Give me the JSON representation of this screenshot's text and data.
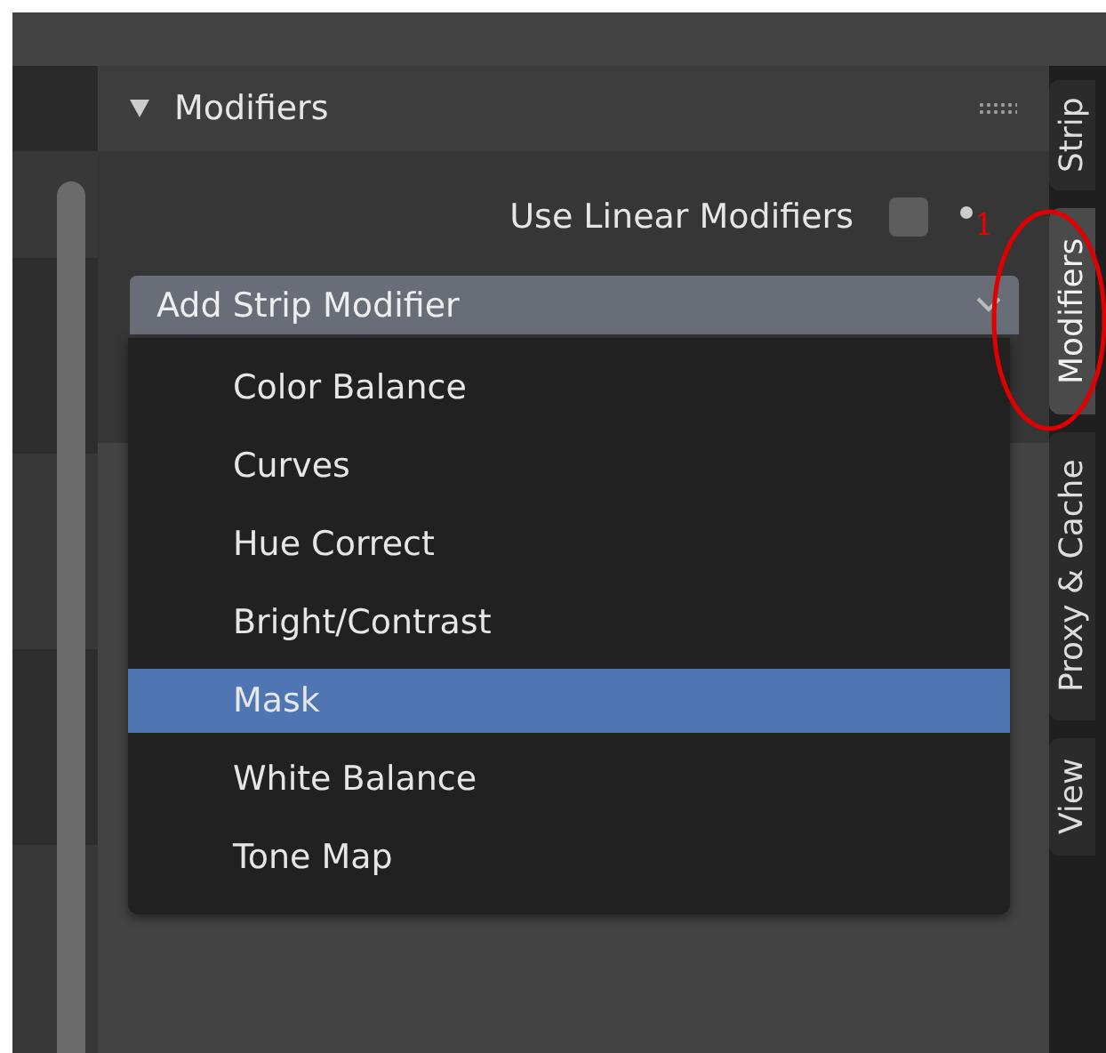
{
  "panel": {
    "title": "Modifiers",
    "expanded": true
  },
  "use_linear_modifiers": {
    "label": "Use Linear Modifiers",
    "checked": false
  },
  "add_modifier_dropdown": {
    "label": "Add Strip Modifier"
  },
  "menu_items": [
    {
      "label": "Color Balance",
      "selected": false
    },
    {
      "label": "Curves",
      "selected": false
    },
    {
      "label": "Hue Correct",
      "selected": false
    },
    {
      "label": "Bright/Contrast",
      "selected": false
    },
    {
      "label": "Mask",
      "selected": true
    },
    {
      "label": "White Balance",
      "selected": false
    },
    {
      "label": "Tone Map",
      "selected": false
    }
  ],
  "side_tabs": [
    {
      "label": "Strip",
      "selected": false
    },
    {
      "label": "Modifiers",
      "selected": true
    },
    {
      "label": "Proxy & Cache",
      "selected": false
    },
    {
      "label": "View",
      "selected": false
    }
  ],
  "annotation": {
    "label": "1"
  }
}
